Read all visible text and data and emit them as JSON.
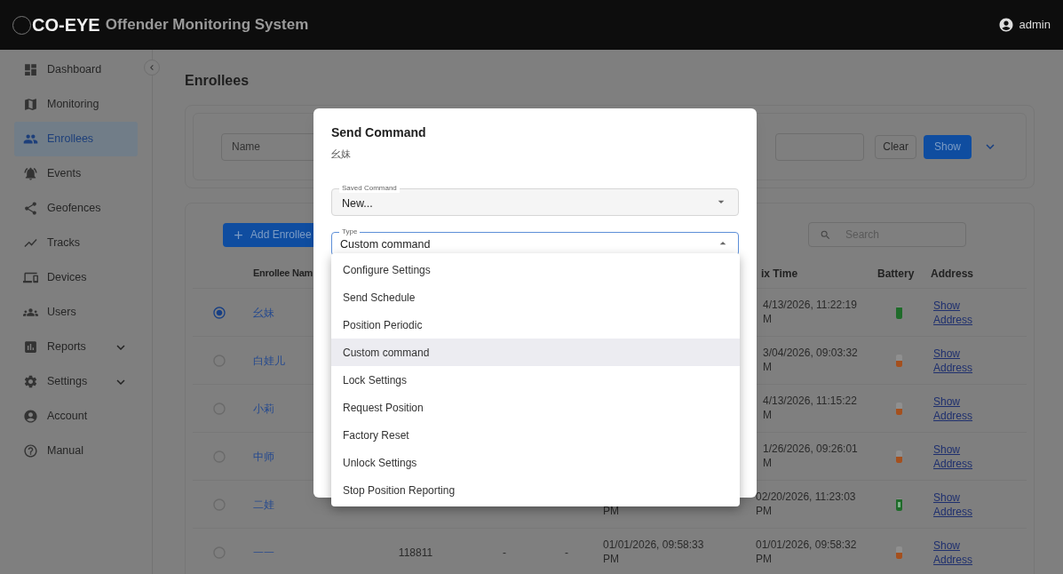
{
  "app_bar": {
    "logo_text": "CO-EYE",
    "title": "Offender Monitoring System",
    "user": "admin"
  },
  "sidebar": {
    "items": [
      {
        "label": "Dashboard",
        "selected": false
      },
      {
        "label": "Monitoring",
        "selected": false
      },
      {
        "label": "Enrollees",
        "selected": true
      },
      {
        "label": "Events",
        "selected": false
      },
      {
        "label": "Geofences",
        "selected": false
      },
      {
        "label": "Tracks",
        "selected": false
      },
      {
        "label": "Devices",
        "selected": false
      },
      {
        "label": "Users",
        "selected": false
      },
      {
        "label": "Reports",
        "selected": false,
        "expanded": false
      },
      {
        "label": "Settings",
        "selected": false,
        "expanded": false
      },
      {
        "label": "Account",
        "selected": false
      },
      {
        "label": "Manual",
        "selected": false
      }
    ]
  },
  "page_title": "Enrollees",
  "filter": {
    "name_placeholder": "Name",
    "clear": "Clear",
    "show": "Show"
  },
  "table": {
    "add_button": "Add Enrollee",
    "search_placeholder": "Search",
    "columns": [
      "Enrollee Nam",
      "ix Time",
      "Battery",
      "Address"
    ],
    "rows": [
      {
        "selected": true,
        "name": "幺妹",
        "fix_time": [
          "4/13/2026, 11:22:19",
          "M"
        ],
        "battery": {
          "level": 0.9,
          "charging": false
        },
        "address": "Show Address"
      },
      {
        "selected": false,
        "name": "白娃儿",
        "fix_time": [
          "3/04/2026, 09:03:32",
          "M"
        ],
        "battery": {
          "level": 0.5,
          "charging": false
        },
        "address": "Show Address"
      },
      {
        "selected": false,
        "name": "小莉",
        "fix_time": [
          "4/13/2026, 11:15:22",
          "M"
        ],
        "battery": {
          "level": 0.5,
          "charging": false
        },
        "address": "Show Address"
      },
      {
        "selected": false,
        "name": "中师",
        "fix_time": [
          "1/26/2026, 09:26:01",
          "M"
        ],
        "battery": {
          "level": 0.5,
          "charging": false
        },
        "address": "Show Address"
      },
      {
        "selected": false,
        "name": "二娃",
        "column_5": [
          "PM"
        ],
        "fix_time": [
          "02/20/2026, 11:23:03",
          "PM"
        ],
        "battery": {
          "level": 0.9,
          "charging": true
        },
        "address": "Show Address"
      },
      {
        "selected": false,
        "name": "一一",
        "column_3": "118811",
        "column_4": "-",
        "column_5a": "-",
        "column_5": [
          "01/01/2026, 09:58:33",
          "PM"
        ],
        "fix_time": [
          "01/01/2026, 09:58:32",
          "PM"
        ],
        "battery": {
          "level": 0.5,
          "charging": false
        },
        "address": "Show Address"
      }
    ]
  },
  "dialog": {
    "title": "Send Command",
    "subtitle": "幺妹",
    "saved_command": {
      "label": "Saved Command",
      "value": "New..."
    },
    "type": {
      "label": "Type",
      "value": "Custom command",
      "expanded": true
    },
    "options": [
      {
        "label": "Configure Settings",
        "selected": false
      },
      {
        "label": "Send Schedule",
        "selected": false
      },
      {
        "label": "Position Periodic",
        "selected": false
      },
      {
        "label": "Custom command",
        "selected": true
      },
      {
        "label": "Lock Settings",
        "selected": false
      },
      {
        "label": "Request Position",
        "selected": false
      },
      {
        "label": "Factory Reset",
        "selected": false
      },
      {
        "label": "Unlock Settings",
        "selected": false
      },
      {
        "label": "Stop Position Reporting",
        "selected": false
      }
    ]
  }
}
